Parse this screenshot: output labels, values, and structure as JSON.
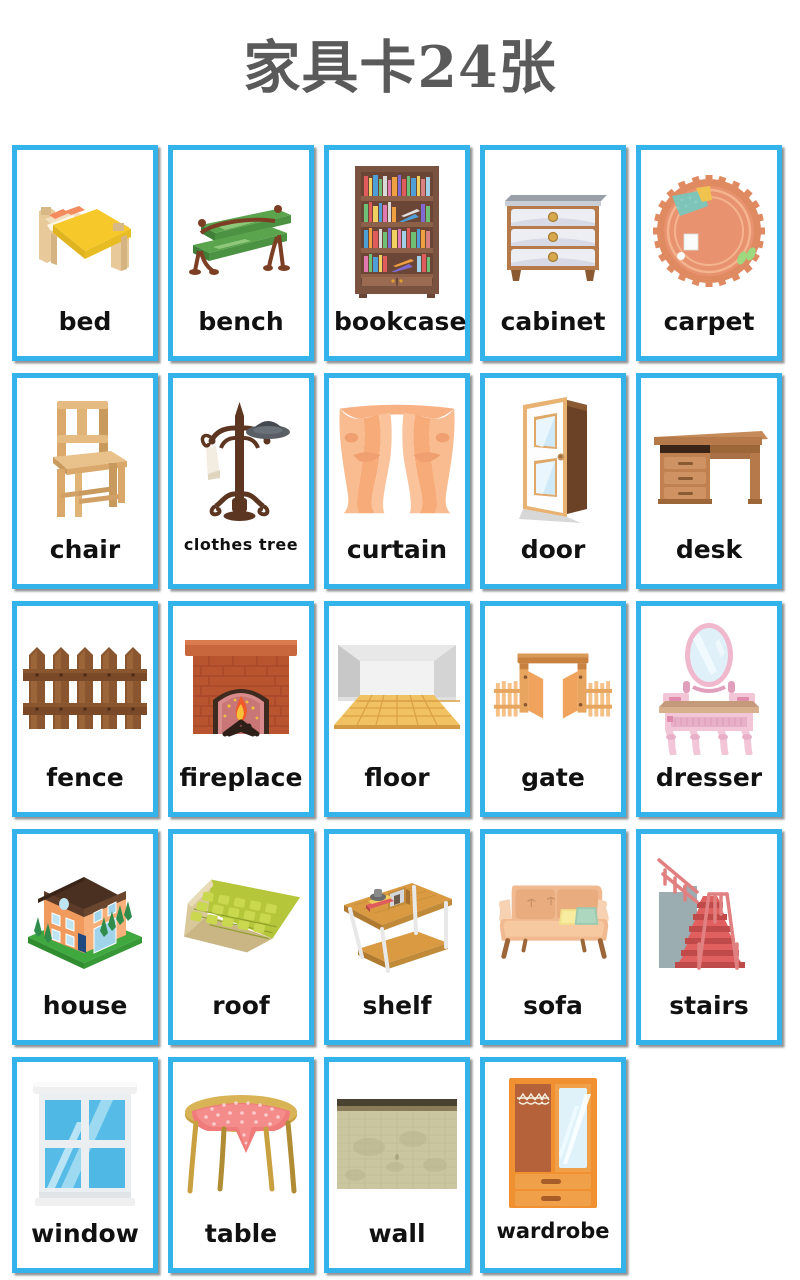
{
  "header": {
    "title": "家具卡24张"
  },
  "theme": {
    "card_border": "#34b3eb",
    "card_background": "#ffffff",
    "page_background": "#ffffff",
    "title_color": "#5a5a5a",
    "label_color": "#111111"
  },
  "cards": [
    {
      "label": "bed",
      "icon": "bed-illustration"
    },
    {
      "label": "bench",
      "icon": "bench-illustration"
    },
    {
      "label": "bookcase",
      "icon": "bookcase-illustration"
    },
    {
      "label": "cabinet",
      "icon": "cabinet-illustration"
    },
    {
      "label": "carpet",
      "icon": "carpet-illustration"
    },
    {
      "label": "chair",
      "icon": "chair-illustration"
    },
    {
      "label": "clothes tree",
      "icon": "clothes-tree-illustration"
    },
    {
      "label": "curtain",
      "icon": "curtain-illustration"
    },
    {
      "label": "door",
      "icon": "door-illustration"
    },
    {
      "label": "desk",
      "icon": "desk-illustration"
    },
    {
      "label": "fence",
      "icon": "fence-illustration"
    },
    {
      "label": "fireplace",
      "icon": "fireplace-illustration"
    },
    {
      "label": "floor",
      "icon": "floor-illustration"
    },
    {
      "label": "gate",
      "icon": "gate-illustration"
    },
    {
      "label": "dresser",
      "icon": "dresser-illustration"
    },
    {
      "label": "house",
      "icon": "house-illustration"
    },
    {
      "label": "roof",
      "icon": "roof-illustration"
    },
    {
      "label": "shelf",
      "icon": "shelf-illustration"
    },
    {
      "label": "sofa",
      "icon": "sofa-illustration"
    },
    {
      "label": "stairs",
      "icon": "stairs-illustration"
    },
    {
      "label": "window",
      "icon": "window-illustration"
    },
    {
      "label": "table",
      "icon": "table-illustration"
    },
    {
      "label": "wall",
      "icon": "wall-illustration"
    },
    {
      "label": "wardrobe",
      "icon": "wardrobe-illustration"
    }
  ]
}
